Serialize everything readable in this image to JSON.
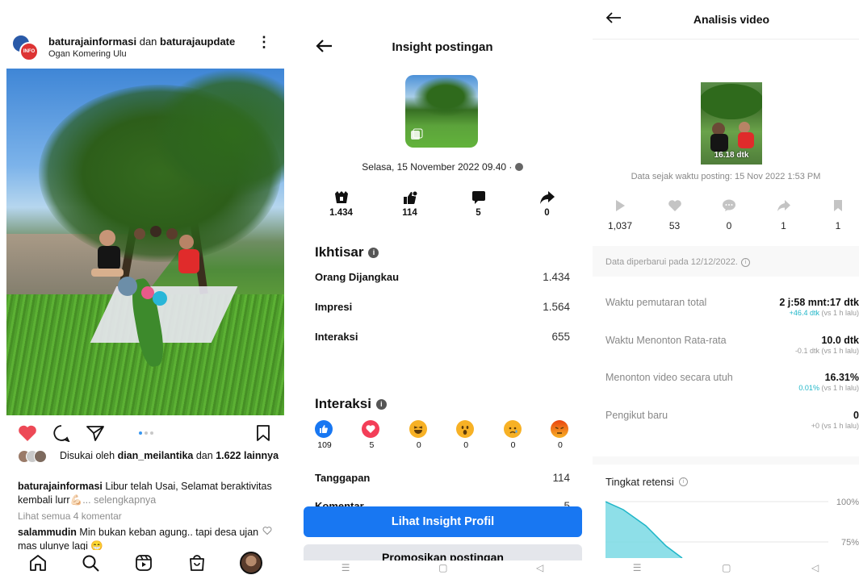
{
  "instagram": {
    "header": {
      "account1": "baturajainformasi",
      "connector": "dan",
      "account2": "baturajaupdate",
      "location": "Ogan Komering Ulu",
      "avatar_badge": "INFO"
    },
    "likes": {
      "prefix": "Disukai oleh",
      "user": "dian_meilantika",
      "middle": "dan",
      "count": "1.622",
      "suffix": "lainnya"
    },
    "caption": {
      "user": "baturajainformasi",
      "text": "Libur telah Usai, Selamat beraktivitas kembali lurr",
      "more": "... selengkapnya"
    },
    "view_comments": "Lihat semua 4 komentar",
    "comment": {
      "user": "salammudin",
      "text": "Min bukan keban agung.. tapi desa ujan mas ulunye lagi"
    },
    "colors": {
      "heart": "#ed4956",
      "dot_active": "#3897f0"
    },
    "icons": [
      "heart-icon",
      "comment-icon",
      "share-icon",
      "bookmark-icon",
      "home-icon",
      "search-icon",
      "reels-icon",
      "shop-icon"
    ]
  },
  "facebook": {
    "title": "Insight postingan",
    "date": "Selasa, 15 November 2022 09.40 ·",
    "stats": [
      {
        "icon": "reach-icon",
        "value": "1.434"
      },
      {
        "icon": "reactions-icon",
        "value": "114"
      },
      {
        "icon": "comment-icon",
        "value": "5"
      },
      {
        "icon": "share-icon",
        "value": "0"
      }
    ],
    "overview": {
      "title": "Ikhtisar",
      "rows": [
        {
          "label": "Orang Dijangkau",
          "value": "1.434"
        },
        {
          "label": "Impresi",
          "value": "1.564"
        },
        {
          "label": "Interaksi",
          "value": "655"
        }
      ]
    },
    "interactions": {
      "title": "Interaksi",
      "reactions": [
        {
          "name": "like",
          "count": "109",
          "color": "#1877f2"
        },
        {
          "name": "love",
          "count": "5",
          "color": "#f33e58"
        },
        {
          "name": "haha",
          "count": "0",
          "color": "#f7b125"
        },
        {
          "name": "wow",
          "count": "0",
          "color": "#f7b125"
        },
        {
          "name": "sad",
          "count": "0",
          "color": "#f7b125"
        },
        {
          "name": "angry",
          "count": "0",
          "color": "#e9710f"
        }
      ],
      "rows": [
        {
          "label": "Tanggapan",
          "value": "114"
        },
        {
          "label": "Komentar",
          "value": "5"
        }
      ]
    },
    "button_primary": "Lihat Insight Profil",
    "button_secondary": "Promosikan postingan",
    "colors": {
      "primary": "#1877f2"
    }
  },
  "tiktok": {
    "title": "Analisis video",
    "thumb_label": "16.18 dtk",
    "since": "Data sejak waktu posting: 15 Nov 2022 1:53 PM",
    "stats": [
      {
        "icon": "play-icon",
        "value": "1,037"
      },
      {
        "icon": "heart-icon",
        "value": "53"
      },
      {
        "icon": "comment-icon",
        "value": "0"
      },
      {
        "icon": "share-icon",
        "value": "1"
      },
      {
        "icon": "bookmark-icon",
        "value": "1"
      }
    ],
    "updated": "Data diperbarui pada 12/12/2022.",
    "metrics": [
      {
        "label": "Waktu pemutaran total",
        "value": "2 j:58 mnt:17 dtk",
        "delta": "+46.4 dtk",
        "delta_suffix": "(vs 1 h lalu)",
        "highlight": true
      },
      {
        "label": "Waktu Menonton Rata-rata",
        "value": "10.0 dtk",
        "delta": "-0.1 dtk",
        "delta_suffix": "(vs 1 h lalu)",
        "highlight": false
      },
      {
        "label": "Menonton video secara utuh",
        "value": "16.31%",
        "delta": "0.01%",
        "delta_suffix": "(vs 1 h lalu)",
        "highlight": true
      },
      {
        "label": "Pengikut baru",
        "value": "0",
        "delta": "+0",
        "delta_suffix": "(vs 1 h lalu)",
        "highlight": false
      }
    ],
    "retention": {
      "title": "Tingkat retensi",
      "tick_100": "100%",
      "tick_75": "75%"
    },
    "colors": {
      "accent": "#20b6c8",
      "chart_fill": "#7ad9e4"
    }
  }
}
